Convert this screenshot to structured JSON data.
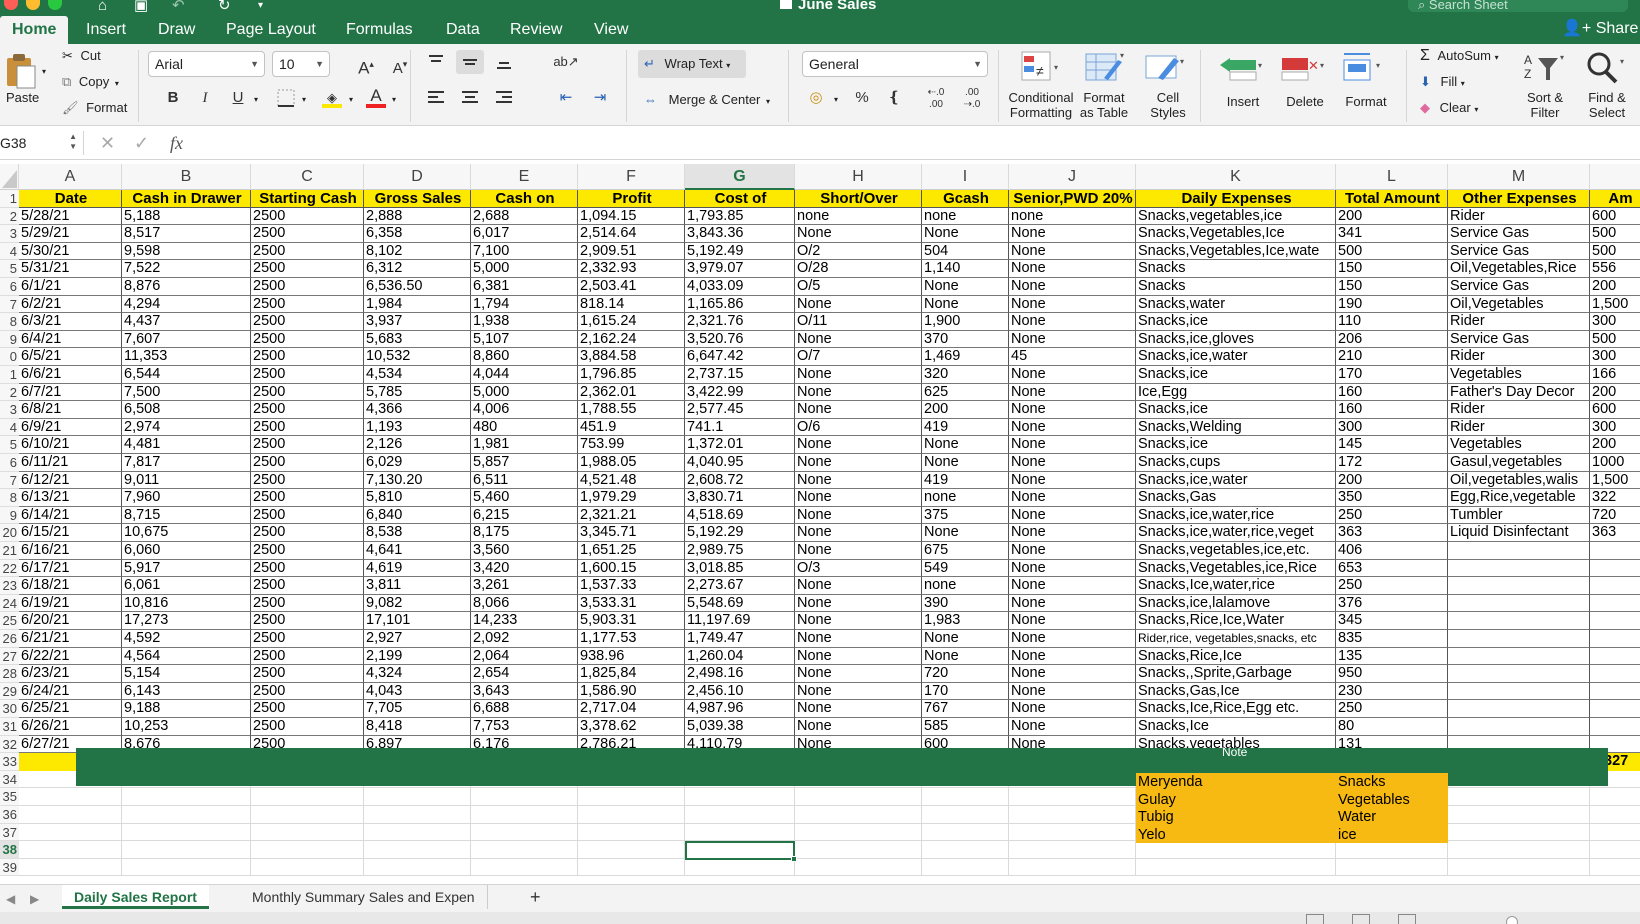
{
  "window": {
    "title": "June Sales",
    "search_placeholder": "Search Sheet",
    "share_label": "Share",
    "tabs": [
      "Home",
      "Insert",
      "Draw",
      "Page Layout",
      "Formulas",
      "Data",
      "Review",
      "View"
    ]
  },
  "ribbon": {
    "paste": "Paste",
    "cut": "Cut",
    "copy": "Copy",
    "format_painter": "Format",
    "font_name": "Arial",
    "font_size": "10",
    "bold": "B",
    "italic": "I",
    "underline": "U",
    "wrap_text": "Wrap Text",
    "merge_center": "Merge & Center",
    "number_format": "General",
    "percent": "%",
    "comma": "❴",
    "conditional_formatting": [
      "Conditional",
      "Formatting"
    ],
    "format_as_table": [
      "Format",
      "as Table"
    ],
    "cell_styles": [
      "Cell",
      "Styles"
    ],
    "insert": "Insert",
    "delete": "Delete",
    "format": "Format",
    "autosum": "AutoSum",
    "fill": "Fill",
    "clear": "Clear",
    "sort_filter": [
      "Sort &",
      "Filter"
    ],
    "find_select": [
      "Find &",
      "Select"
    ]
  },
  "formula_bar": {
    "name_box": "G38",
    "formula": ""
  },
  "sheet": {
    "columns": [
      "A",
      "B",
      "C",
      "D",
      "E",
      "F",
      "G",
      "H",
      "I",
      "J",
      "K",
      "L",
      "M",
      ""
    ],
    "selected_column": "G",
    "selected_row": "38",
    "row_numbers": [
      "1",
      "2",
      "3",
      "4",
      "5",
      "6",
      "7",
      "8",
      "9",
      "0",
      "1",
      "2",
      "3",
      "4",
      "5",
      "6",
      "7",
      "8",
      "9",
      "20",
      "21",
      "22",
      "23",
      "24",
      "25",
      "26",
      "27",
      "28",
      "29",
      "30",
      "31",
      "32",
      "33",
      "34",
      "35",
      "36",
      "37",
      "38",
      "39"
    ],
    "headers": [
      "Date",
      "Cash in Drawer",
      "Starting Cash",
      "Gross Sales",
      "Cash on",
      "Profit",
      "Cost of",
      "Short/Over",
      "Gcash",
      "Senior,PWD 20%",
      "Daily Expenses",
      "Total Amount",
      "Other Expenses",
      "Am"
    ],
    "rows": [
      [
        "5/28/21",
        "5,188",
        "2500",
        "2,888",
        "2,688",
        "1,094.15",
        "1,793.85",
        "none",
        "none",
        "none",
        "Snacks,vegetables,ice",
        "200",
        "Rider",
        "600"
      ],
      [
        "5/29/21",
        "8,517",
        "2500",
        "6,358",
        "6,017",
        "2,514.64",
        "3,843.36",
        "None",
        "None",
        "None",
        "Snacks,Vegetables,Ice",
        "341",
        "Service Gas",
        "500"
      ],
      [
        "5/30/21",
        "9,598",
        "2500",
        "8,102",
        "7,100",
        "2,909.51",
        "5,192.49",
        "O/2",
        "504",
        "None",
        "Snacks,Vegetables,Ice,wate",
        "500",
        "Service Gas",
        "500"
      ],
      [
        "5/31/21",
        "7,522",
        "2500",
        "6,312",
        "5,000",
        "2,332.93",
        "3,979.07",
        "O/28",
        "1,140",
        "None",
        "Snacks",
        "150",
        "Oil,Vegetables,Rice",
        "556"
      ],
      [
        "6/1/21",
        "8,876",
        "2500",
        "6,536.50",
        "6,381",
        "2,503.41",
        "4,033.09",
        "O/5",
        "None",
        "None",
        "Snacks",
        "150",
        "Service Gas",
        "200"
      ],
      [
        "6/2/21",
        "4,294",
        "2500",
        "1,984",
        "1,794",
        "818.14",
        "1,165.86",
        "None",
        "None",
        "None",
        "Snacks,water",
        "190",
        "Oil,Vegetables",
        "1,500"
      ],
      [
        "6/3/21",
        "4,437",
        "2500",
        "3,937",
        "1,938",
        "1,615.24",
        "2,321.76",
        "O/11",
        "1,900",
        "None",
        "Snacks,ice",
        "110",
        "Rider",
        "300"
      ],
      [
        "6/4/21",
        "7,607",
        "2500",
        "5,683",
        "5,107",
        "2,162.24",
        "3,520.76",
        "None",
        "370",
        "None",
        "Snacks,ice,gloves",
        "206",
        "Service Gas",
        "500"
      ],
      [
        "6/5/21",
        "11,353",
        "2500",
        "10,532",
        "8,860",
        "3,884.58",
        "6,647.42",
        "O/7",
        "1,469",
        "45",
        "Snacks,ice,water",
        "210",
        "Rider",
        "300"
      ],
      [
        "6/6/21",
        "6,544",
        "2500",
        "4,534",
        "4,044",
        "1,796.85",
        "2,737.15",
        "None",
        "320",
        "None",
        "Snacks,ice",
        "170",
        "Vegetables",
        "166"
      ],
      [
        "6/7/21",
        "7,500",
        "2500",
        "5,785",
        "5,000",
        "2,362.01",
        "3,422.99",
        "None",
        "625",
        "None",
        "Ice,Egg",
        "160",
        "Father's Day Decor",
        "200"
      ],
      [
        "6/8/21",
        "6,508",
        "2500",
        "4,366",
        "4,006",
        "1,788.55",
        "2,577.45",
        "None",
        "200",
        "None",
        "Snacks,ice",
        "160",
        "Rider",
        "600"
      ],
      [
        "6/9/21",
        "2,974",
        "2500",
        "1,193",
        "480",
        "451.9",
        "741.1",
        "O/6",
        "419",
        "None",
        "Snacks,Welding",
        "300",
        "Rider",
        "300"
      ],
      [
        "6/10/21",
        "4,481",
        "2500",
        "2,126",
        "1,981",
        "753.99",
        "1,372.01",
        "None",
        "None",
        "None",
        "Snacks,ice",
        "145",
        "Vegetables",
        "200"
      ],
      [
        "6/11/21",
        "7,817",
        "2500",
        "6,029",
        "5,857",
        "1,988.05",
        "4,040.95",
        "None",
        "None",
        "None",
        "Snacks,cups",
        "172",
        "Gasul,vegetables",
        "1000"
      ],
      [
        "6/12/21",
        "9,011",
        "2500",
        "7,130.20",
        "6,511",
        "4,521.48",
        "2,608.72",
        "None",
        "419",
        "None",
        "Snacks,ice,water",
        "200",
        "Oil,vegetables,walis",
        "1,500"
      ],
      [
        "6/13/21",
        "7,960",
        "2500",
        "5,810",
        "5,460",
        "1,979.29",
        "3,830.71",
        "None",
        "none",
        "None",
        "Snacks,Gas",
        "350",
        "Egg,Rice,vegetable",
        "322"
      ],
      [
        "6/14/21",
        "8,715",
        "2500",
        "6,840",
        "6,215",
        "2,321.21",
        "4,518.69",
        "None",
        "375",
        "None",
        "Snacks,ice,water,rice",
        "250",
        "Tumbler",
        "720"
      ],
      [
        "6/15/21",
        "10,675",
        "2500",
        "8,538",
        "8,175",
        "3,345.71",
        "5,192.29",
        "None",
        "None",
        "None",
        "Snacks,ice,water,rice,veget",
        "363",
        "Liquid Disinfectant",
        "363"
      ],
      [
        "6/16/21",
        "6,060",
        "2500",
        "4,641",
        "3,560",
        "1,651.25",
        "2,989.75",
        "None",
        "675",
        "None",
        "Snacks,vegetables,ice,etc.",
        "406",
        "",
        ""
      ],
      [
        "6/17/21",
        "5,917",
        "2500",
        "4,619",
        "3,420",
        "1,600.15",
        "3,018.85",
        "O/3",
        "549",
        "None",
        "Snacks,Vegetables,ice,Rice",
        "653",
        "",
        ""
      ],
      [
        "6/18/21",
        "6,061",
        "2500",
        "3,811",
        "3,261",
        "1,537.33",
        "2,273.67",
        "None",
        "none",
        "None",
        "Snacks,Ice,water,rice",
        "250",
        "",
        ""
      ],
      [
        "6/19/21",
        "10,816",
        "2500",
        "9,082",
        "8,066",
        "3,533.31",
        "5,548.69",
        "None",
        "390",
        "None",
        "Snacks,ice,lalamove",
        "376",
        "",
        ""
      ],
      [
        "6/20/21",
        "17,273",
        "2500",
        "17,101",
        "14,233",
        "5,903.31",
        "11,197.69",
        "None",
        "1,983",
        "None",
        "Snacks,Rice,Ice,Water",
        "345",
        "",
        ""
      ],
      [
        "6/21/21",
        "4,592",
        "2500",
        "2,927",
        "2,092",
        "1,177.53",
        "1,749.47",
        "None",
        "None",
        "None",
        "Rider,rice, vegetables,snacks, etc",
        "835",
        "",
        ""
      ],
      [
        "6/22/21",
        "4,564",
        "2500",
        "2,199",
        "2,064",
        "938.96",
        "1,260.04",
        "None",
        "None",
        "None",
        "Snacks,Rice,Ice",
        "135",
        "",
        ""
      ],
      [
        "6/23/21",
        "5,154",
        "2500",
        "4,324",
        "2,654",
        "1,825,84",
        "2,498.16",
        "None",
        "720",
        "None",
        "Snacks,,Sprite,Garbage",
        "950",
        "",
        ""
      ],
      [
        "6/24/21",
        "6,143",
        "2500",
        "4,043",
        "3,643",
        "1,586.90",
        "2,456.10",
        "None",
        "170",
        "None",
        "Snacks,Gas,Ice",
        "230",
        "",
        ""
      ],
      [
        "6/25/21",
        "9,188",
        "2500",
        "7,705",
        "6,688",
        "2,717.04",
        "4,987.96",
        "None",
        "767",
        "None",
        "Snacks,Ice,Rice,Egg etc.",
        "250",
        "",
        ""
      ],
      [
        "6/26/21",
        "10,253",
        "2500",
        "8,418",
        "7,753",
        "3,378.62",
        "5,039.38",
        "None",
        "585",
        "None",
        "Snacks,Ice",
        "80",
        "",
        ""
      ],
      [
        "6/27/21",
        "8,676",
        "2500",
        "6,897",
        "6,176",
        "2,786.21",
        "4,110.79",
        "None",
        "600",
        "None",
        "Snacks,vegetables",
        "131",
        "",
        ""
      ]
    ],
    "totals_tail": "327",
    "legend": {
      "heading": "Note",
      "rows": [
        [
          "Meryenda",
          "Snacks"
        ],
        [
          "Gulay",
          "Vegetables"
        ],
        [
          "Tubig",
          "Water"
        ],
        [
          "Yelo",
          "ice"
        ]
      ]
    }
  },
  "sheet_tabs": {
    "tabs": [
      "Daily Sales Report",
      "Monthly Summary Sales and Expen"
    ],
    "active_index": 0,
    "add_label": "+"
  },
  "colors": {
    "excel_green": "#227447",
    "header_yellow": "#fde900",
    "legend_orange": "#f7ba12"
  }
}
